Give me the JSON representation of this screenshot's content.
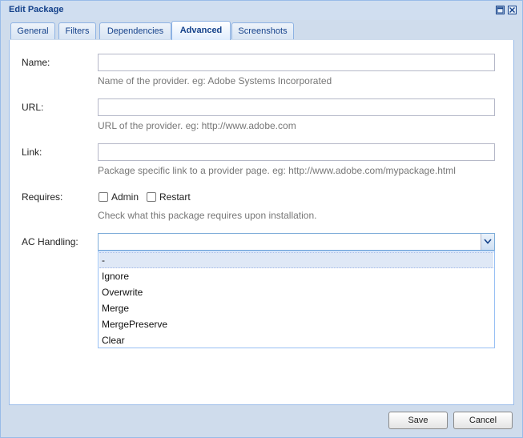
{
  "dialog": {
    "title": "Edit Package"
  },
  "tabs": [
    {
      "label": "General"
    },
    {
      "label": "Filters"
    },
    {
      "label": "Dependencies"
    },
    {
      "label": "Advanced",
      "active": true
    },
    {
      "label": "Screenshots"
    }
  ],
  "form": {
    "name": {
      "label": "Name:",
      "value": "",
      "hint": "Name of the provider. eg: Adobe Systems Incorporated"
    },
    "url": {
      "label": "URL:",
      "value": "",
      "hint": "URL of the provider. eg: http://www.adobe.com"
    },
    "link": {
      "label": "Link:",
      "value": "",
      "hint": "Package specific link to a provider page. eg: http://www.adobe.com/mypackage.html"
    },
    "requires": {
      "label": "Requires:",
      "options": [
        {
          "label": "Admin",
          "checked": false
        },
        {
          "label": "Restart",
          "checked": false
        }
      ],
      "hint": "Check what this package requires upon installation."
    },
    "ac_handling": {
      "label": "AC Handling:",
      "value": "",
      "options": [
        "-",
        "Ignore",
        "Overwrite",
        "Merge",
        "MergePreserve",
        "Clear"
      ],
      "highlighted_option": "-"
    }
  },
  "buttons": {
    "save": "Save",
    "cancel": "Cancel"
  },
  "colors": {
    "header_text": "#15428b",
    "border": "#99bbe8",
    "hint_text": "#777777"
  }
}
